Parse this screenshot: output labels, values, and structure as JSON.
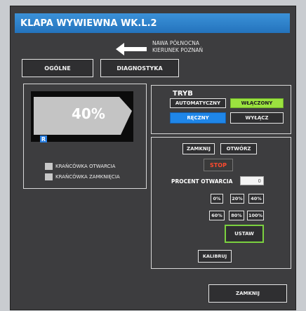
{
  "window": {
    "title": "KLAPA WYWIEWNA WK.L.2"
  },
  "direction": {
    "line1": "NAWA PÓŁNOCNA",
    "line2": "KIERUNEK POZNAŃ"
  },
  "tabs": {
    "general": "OGÓLNE",
    "diagnostics": "DIAGNOSTYKA"
  },
  "gauge": {
    "value": "40%",
    "badge": "R",
    "opening_fraction": 0.4
  },
  "limits": {
    "open": "KRAŃCÓWKA OTWARCIA",
    "closed": "KRAŃCÓWKA ZAMKNIĘCIA"
  },
  "mode": {
    "label": "TRYB",
    "automatic": "AUTOMATYCZNY",
    "on": "WŁĄCZONY",
    "manual": "RĘCZNY",
    "off": "WYŁĄCZ"
  },
  "control": {
    "close": "ZAMKNIJ",
    "open": "OTWÓRZ",
    "stop": "STOP",
    "percent_label": "PROCENT OTWARCIA",
    "percent_value": "0",
    "presets": [
      "0%",
      "20%",
      "40%",
      "60%",
      "80%",
      "100%"
    ],
    "set": "USTAW",
    "calibrate": "KALIBRUJ"
  },
  "footer": {
    "close": "ZAMKNIJ"
  },
  "colors": {
    "title_bar": "#2f83cc",
    "on_green": "#9be23f",
    "manual_blue": "#1f86e8",
    "stop_red": "#ff4a2e",
    "set_border": "#7bd13f"
  }
}
